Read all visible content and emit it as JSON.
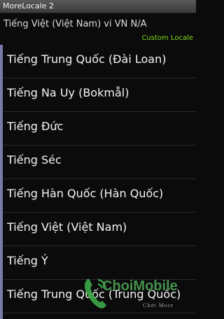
{
  "app": {
    "title": "MoreLocale 2"
  },
  "current": {
    "label": "Tiếng Việt (Việt Nam)  vi VN N/A"
  },
  "custom_locale": {
    "label": "Custom Locale"
  },
  "locales": [
    "Tiếng Trung Quốc (Đài Loan)",
    "Tiếng Na Uy (Bokmål)",
    "Tiếng Đức",
    "Tiếng Séc",
    "Tiếng Hàn Quốc (Hàn Quốc)",
    "Tiếng Việt (Việt Nam)",
    "Tiếng Ý",
    "Tiếng Trung Quốc (Trung Quốc)"
  ],
  "watermark": {
    "brand": "ChoiMobile",
    "tagline": "Chơi More"
  },
  "colors": {
    "accent": "#7a7aa8",
    "custom_locale": "#7ddc1a",
    "watermark": "#50aa5a"
  }
}
